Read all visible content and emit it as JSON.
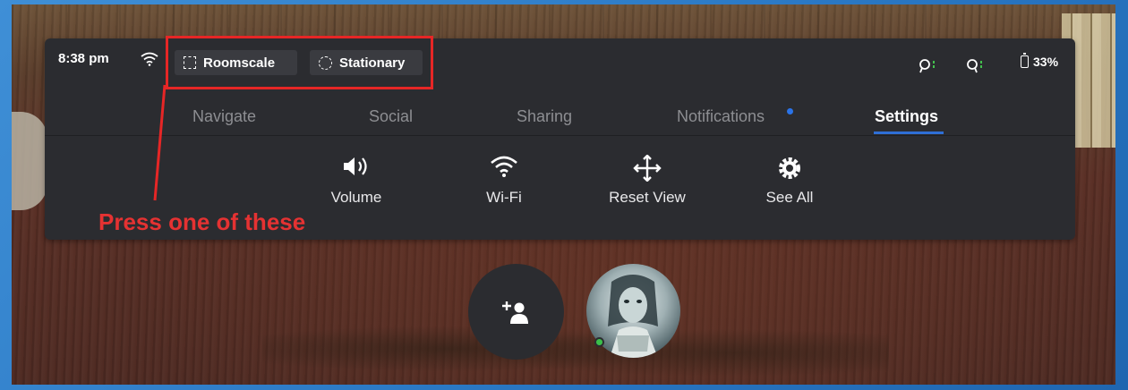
{
  "status_bar": {
    "time": "8:38 pm",
    "wifi_icon": "wifi-icon",
    "battery_percent": "33%",
    "battery_level": 0.33
  },
  "modes": {
    "roomscale_label": "Roomscale",
    "stationary_label": "Stationary"
  },
  "tabs": [
    {
      "label": "Navigate",
      "active": false
    },
    {
      "label": "Social",
      "active": false
    },
    {
      "label": "Sharing",
      "active": false
    },
    {
      "label": "Notifications",
      "active": false,
      "badge": true
    },
    {
      "label": "Settings",
      "active": true
    }
  ],
  "quick_settings": [
    {
      "label": "Volume",
      "icon": "volume-icon"
    },
    {
      "label": "Wi-Fi",
      "icon": "wifi-icon"
    },
    {
      "label": "Reset View",
      "icon": "move-arrows-icon"
    },
    {
      "label": "See All",
      "icon": "gear-icon"
    }
  ],
  "annotation": {
    "text": "Press one of these",
    "color": "#e62626"
  },
  "colors": {
    "panel": "#2b2c30",
    "accent_blue": "#2f6fd6",
    "online_green": "#3bbf4a"
  }
}
